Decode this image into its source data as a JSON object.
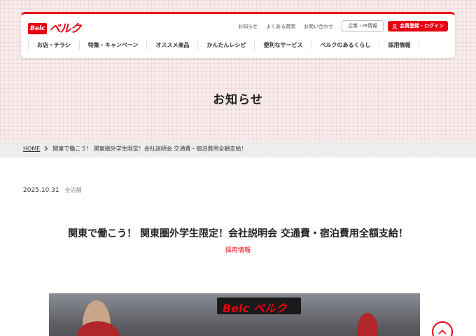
{
  "brand": {
    "logo_box": "Belc",
    "logo_text": "ベルク"
  },
  "header": {
    "util_links": [
      "お知らせ",
      "よくある質問",
      "お問い合わせ"
    ],
    "corp_button": "企業・IR情報",
    "login_button": "会員登録・ログイン"
  },
  "nav": [
    "お店・チラシ",
    "特集・キャンペーン",
    "オススメ商品",
    "かんたんレシピ",
    "便利なサービス",
    "ベルクのあるくらし",
    "採用情報"
  ],
  "page_title": "お知らせ",
  "breadcrumb": {
    "home": "HOME",
    "current": "関東で働こう！ 関東圏外学生限定！会社説明会 交通費・宿泊費用全額支給！"
  },
  "article": {
    "date": "2025.10.31",
    "store": "全店舗",
    "title": "関東で働こう！ 関東圏外学生限定！会社説明会 交通費・宿泊費用全額支給！",
    "category": "採用情報"
  },
  "photo_sign": "Belc ベルク",
  "colors": {
    "brand_red": "#e60012",
    "hero_bg": "#f8ecec"
  },
  "icons": {
    "login": "user-icon",
    "scroll_top": "chevron-up-icon",
    "breadcrumb_sep": "chevron-right-icon"
  }
}
